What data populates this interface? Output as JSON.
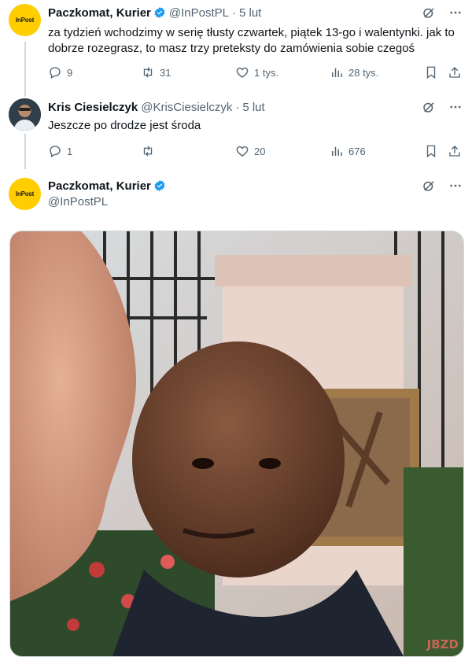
{
  "tweets": [
    {
      "name": "Paczkomat, Kurier",
      "handle": "@InPostPL",
      "dot": "·",
      "time": "5 lut",
      "avatar_label": "InPost",
      "text": "za tydzień wchodzimy w serię tłusty czwartek, piątek 13-go i walentynki. jak to dobrze rozegrasz, to masz trzy preteksty do zamówienia sobie czegoś",
      "replies": "9",
      "retweets": "31",
      "likes": "1 tys.",
      "views": "28 tys."
    },
    {
      "name": "Kris Ciesielczyk",
      "handle": "@KrisCiesielczyk",
      "dot": "·",
      "time": "5 lut",
      "text": "Jeszcze po drodze jest środa",
      "replies": "1",
      "retweets": "",
      "likes": "20",
      "views": "676"
    },
    {
      "name": "Paczkomat, Kurier",
      "handle": "@InPostPL",
      "avatar_label": "InPost"
    }
  ],
  "media": {
    "description_icon": "meme-photo",
    "watermark": "JBZD"
  },
  "colors": {
    "accent_blue": "#1d9bf0",
    "muted": "#536471",
    "inpost_yellow": "#ffcd00"
  }
}
